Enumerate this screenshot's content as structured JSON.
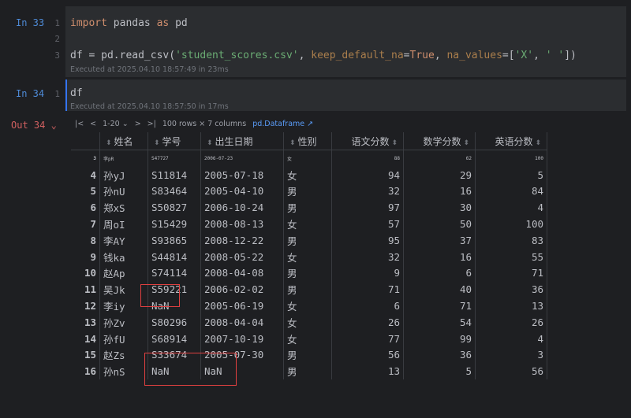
{
  "cells": [
    {
      "label": "In 33",
      "lines": [
        "1",
        "2",
        "3"
      ],
      "code_line1_kw": "import",
      "code_line1_mid": " pandas ",
      "code_line1_as": "as",
      "code_line1_end": " pd",
      "code_line3_a": "df = pd.read_csv(",
      "code_line3_str": "'student_scores.csv'",
      "code_line3_b": ", ",
      "code_line3_p1": "keep_default_na",
      "code_line3_c": "=",
      "code_line3_true": "True",
      "code_line3_d": ", ",
      "code_line3_p2": "na_values",
      "code_line3_e": "=[",
      "code_line3_s2": "'X'",
      "code_line3_f": ", ",
      "code_line3_s3": "' '",
      "code_line3_g": "])",
      "exec": "Executed at 2025.04.10 18:57:49 in 23ms"
    },
    {
      "label": "In 34",
      "lines": [
        "1"
      ],
      "code": "df",
      "exec": "Executed at 2025.04.10 18:57:50 in 17ms"
    }
  ],
  "output": {
    "label": "Out 34",
    "pager": "1-20",
    "summary": "100 rows × 7 columns",
    "type_link": "pd.Dataframe ↗"
  },
  "table": {
    "columns": [
      "姓名",
      "学号",
      "出生日期",
      "性别",
      "语文分数",
      "数学分数",
      "英语分数"
    ],
    "cut_row": {
      "idx": "3",
      "name": "李pR",
      "id": "S47727",
      "date": "2006-07-23",
      "sex": "女",
      "c": "88",
      "m": "62",
      "e": "100"
    },
    "rows": [
      {
        "idx": "4",
        "name": "孙yJ",
        "id": "S11814",
        "date": "2005-07-18",
        "sex": "女",
        "c": "94",
        "m": "29",
        "e": "5"
      },
      {
        "idx": "5",
        "name": "孙nU",
        "id": "S83464",
        "date": "2005-04-10",
        "sex": "男",
        "c": "32",
        "m": "16",
        "e": "84"
      },
      {
        "idx": "6",
        "name": "郑xS",
        "id": "S50827",
        "date": "2006-10-24",
        "sex": "男",
        "c": "97",
        "m": "30",
        "e": "4"
      },
      {
        "idx": "7",
        "name": "周oI",
        "id": "S15429",
        "date": "2008-08-13",
        "sex": "女",
        "c": "57",
        "m": "50",
        "e": "100"
      },
      {
        "idx": "8",
        "name": "李AY",
        "id": "S93865",
        "date": "2008-12-22",
        "sex": "男",
        "c": "95",
        "m": "37",
        "e": "83"
      },
      {
        "idx": "9",
        "name": "钱ka",
        "id": "S44814",
        "date": "2008-05-22",
        "sex": "女",
        "c": "32",
        "m": "16",
        "e": "55"
      },
      {
        "idx": "10",
        "name": "赵Ap",
        "id": "S74114",
        "date": "2008-04-08",
        "sex": "男",
        "c": "9",
        "m": "6",
        "e": "71"
      },
      {
        "idx": "11",
        "name": "吴Jk",
        "id": "S59221",
        "date": "2006-02-02",
        "sex": "男",
        "c": "71",
        "m": "40",
        "e": "36"
      },
      {
        "idx": "12",
        "name": "李iy",
        "id": "NaN",
        "date": "2005-06-19",
        "sex": "女",
        "c": "6",
        "m": "71",
        "e": "13"
      },
      {
        "idx": "13",
        "name": "孙Zv",
        "id": "S80296",
        "date": "2008-04-04",
        "sex": "女",
        "c": "26",
        "m": "54",
        "e": "26"
      },
      {
        "idx": "14",
        "name": "孙fU",
        "id": "S68914",
        "date": "2007-10-19",
        "sex": "女",
        "c": "77",
        "m": "99",
        "e": "4"
      },
      {
        "idx": "15",
        "name": "赵Zs",
        "id": "S33674",
        "date": "2005-07-30",
        "sex": "男",
        "c": "56",
        "m": "36",
        "e": "3"
      },
      {
        "idx": "16",
        "name": "孙nS",
        "id": "NaN",
        "date": "NaN",
        "sex": "男",
        "c": "13",
        "m": "5",
        "e": "56"
      }
    ]
  }
}
